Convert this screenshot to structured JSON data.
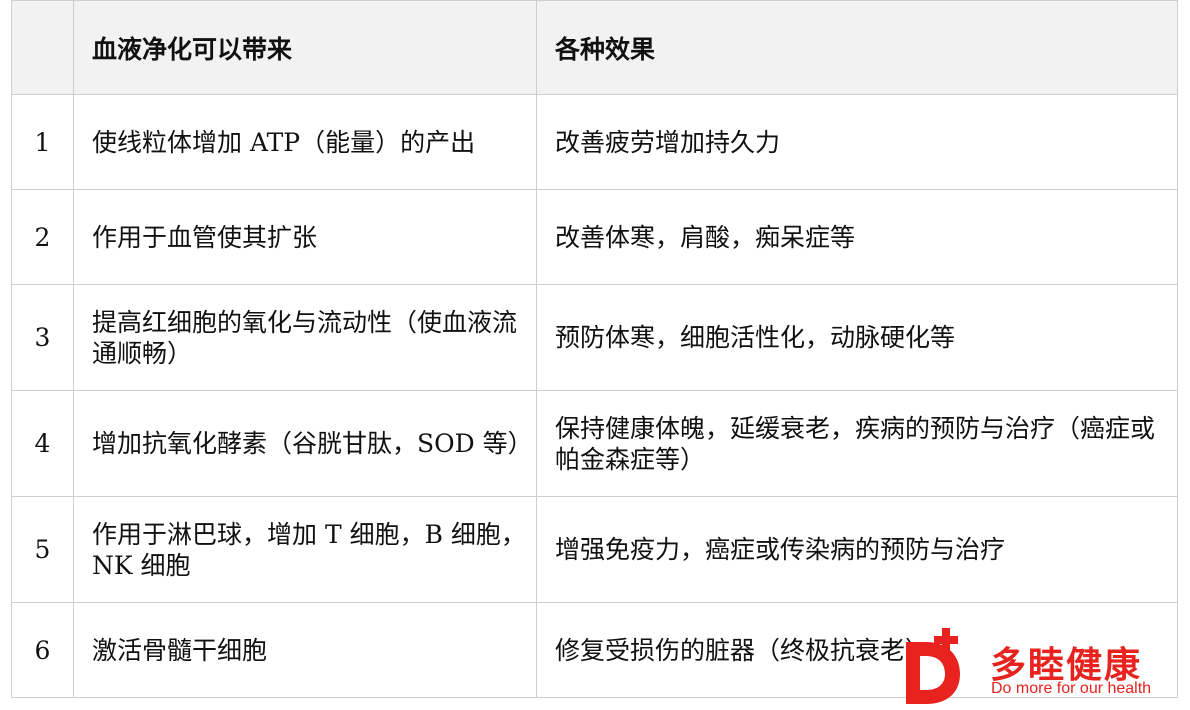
{
  "table": {
    "headers": [
      "",
      "血液净化可以带来",
      "各种效果"
    ],
    "rows": [
      {
        "num": "1",
        "benefit": "使线粒体增加 ATP（能量）的产出",
        "effect": "改善疲劳增加持久力"
      },
      {
        "num": "2",
        "benefit": "作用于血管使其扩张",
        "effect": "改善体寒，肩酸，痴呆症等"
      },
      {
        "num": "3",
        "benefit": "提高红细胞的氧化与流动性（使血液流通顺畅）",
        "effect": "预防体寒，细胞活性化，动脉硬化等"
      },
      {
        "num": "4",
        "benefit": "增加抗氧化酵素（谷胱甘肽，SOD 等）",
        "effect": "保持健康体魄，延缓衰老，疾病的预防与治疗（癌症或帕金森症等）"
      },
      {
        "num": "5",
        "benefit": "作用于淋巴球，增加 T 细胞，B 细胞，NK 细胞",
        "effect": "增强免疫力，癌症或传染病的预防与治疗"
      },
      {
        "num": "6",
        "benefit": "激活骨髓干细胞",
        "effect": "修复受损伤的脏器（终极抗衰老）"
      }
    ]
  },
  "logo": {
    "name_cn": "多睦健康",
    "slogan_parts": {
      "a": "Do mo",
      "b": "re for our health"
    },
    "brand_color": "#e8231f",
    "icon": "d-plus-logo-icon"
  }
}
